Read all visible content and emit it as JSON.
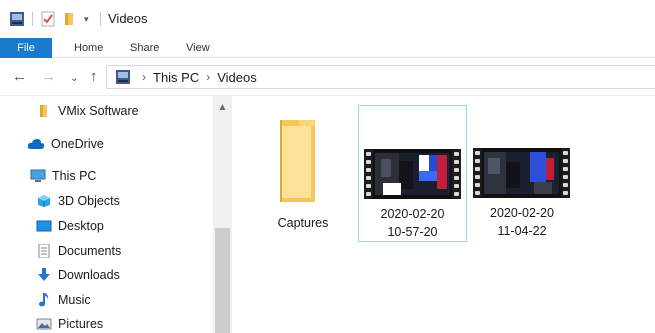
{
  "window": {
    "title": "Videos"
  },
  "ribbon": {
    "file_label": "File",
    "tabs": [
      "Home",
      "Share",
      "View"
    ]
  },
  "address": {
    "path": [
      "This PC",
      "Videos"
    ]
  },
  "sidebar": {
    "items": [
      {
        "label": "VMix Software",
        "icon": "folder-icon"
      },
      {
        "label": "OneDrive",
        "icon": "cloud-icon"
      },
      {
        "label": "This PC",
        "icon": "computer-icon"
      },
      {
        "label": "3D Objects",
        "icon": "cube-icon"
      },
      {
        "label": "Desktop",
        "icon": "desktop-icon"
      },
      {
        "label": "Documents",
        "icon": "document-icon"
      },
      {
        "label": "Downloads",
        "icon": "download-icon"
      },
      {
        "label": "Music",
        "icon": "music-icon"
      },
      {
        "label": "Pictures",
        "icon": "pictures-icon"
      }
    ]
  },
  "content": {
    "items": [
      {
        "label": "Captures",
        "type": "folder"
      },
      {
        "label": "2020-02-20\n10-57-20",
        "type": "video"
      },
      {
        "label": "2020-02-20\n11-04-22",
        "type": "video"
      }
    ]
  },
  "colors": {
    "accent": "#1979ca",
    "selection_border": "#99d1ff",
    "folder": "#f5c65b"
  }
}
